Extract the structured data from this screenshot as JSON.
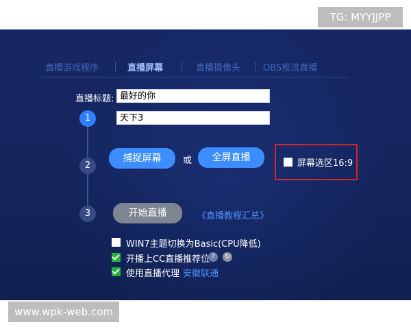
{
  "badges": {
    "tg": "TG: MYYJJPP",
    "watermark": "www.wpk-web.com"
  },
  "tabs": [
    {
      "label": "直播游戏程序",
      "active": false
    },
    {
      "label": "直播屏幕",
      "active": true
    },
    {
      "label": "直播摄像头",
      "active": false
    },
    {
      "label": "OBS推流直播",
      "active": false
    }
  ],
  "form": {
    "title_label": "直播标题:",
    "title_value": "最好的你",
    "game_value": "天下3"
  },
  "steps": [
    "1",
    "2",
    "3"
  ],
  "buttons": {
    "capture_screen": "捕捉屏幕",
    "or": "或",
    "fullscreen_live": "全屏直播",
    "start_live": "开始直播"
  },
  "ratio": {
    "label": "屏幕选区16:9",
    "checked": false
  },
  "tutorial_link": "《直播教程汇总》",
  "options": [
    {
      "label": "WIN7主题切换为Basic(CPU降低)",
      "checked": false
    },
    {
      "label": "开播上CC直播推荐位",
      "checked": true
    },
    {
      "label": "使用直播代理",
      "checked": true,
      "link": "安徽联通"
    }
  ],
  "icons": {
    "help": "?",
    "refresh": "↻"
  },
  "colors": {
    "accent": "#3c8dff",
    "check": "#23b338",
    "highlight": "#d9232a",
    "panel": "#162764"
  }
}
